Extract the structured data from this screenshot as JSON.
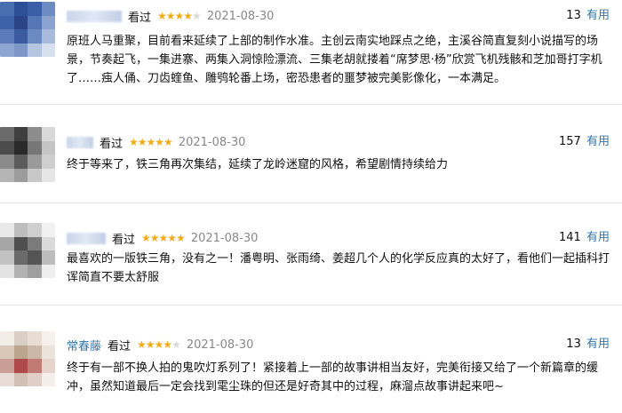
{
  "reviews": [
    {
      "name": "",
      "verb": "看过",
      "rating": 4,
      "date": "2021-08-30",
      "useful_count": "13",
      "useful_label": "有用",
      "text": "原班人马重聚，目前看来延续了上部的制作水准。主创云南实地踩点之绝，主溪谷简直复刻小说描写的场景，节奏起飞，一集进寨、两集入洞惊险漂流、三集老胡就搂着“席梦思·杨”欣赏飞机残骸和芝加哥打字机了……痋人俑、刀齿蝰鱼、雕鸮轮番上场，密恐患者的噩梦被完美影像化，一本满足。"
    },
    {
      "name": "",
      "verb": "看过",
      "rating": 5,
      "date": "2021-08-30",
      "useful_count": "157",
      "useful_label": "有用",
      "text": "终于等来了，铁三角再次集结，延续了龙岭迷窟的风格，希望剧情持续给力"
    },
    {
      "name": "",
      "verb": "看过",
      "rating": 5,
      "date": "2021-08-30",
      "useful_count": "141",
      "useful_label": "有用",
      "text": "最喜欢的一版铁三角，没有之一！潘粤明、张雨绮、姜超几个人的化学反应真的太好了，看他们一起插科打诨简直不要太舒服"
    },
    {
      "name": "常春藤",
      "verb": "看过",
      "rating": 4,
      "date": "2021-08-30",
      "useful_count": "13",
      "useful_label": "有用",
      "text": "终于有一部不换人拍的鬼吹灯系列了！紧接着上一部的故事讲相当友好，完美衔接又给了一个新篇章的缓冲，虽然知道最后一定会找到雮尘珠的但还是好奇其中的过程，麻溜点故事讲起来吧~"
    }
  ]
}
